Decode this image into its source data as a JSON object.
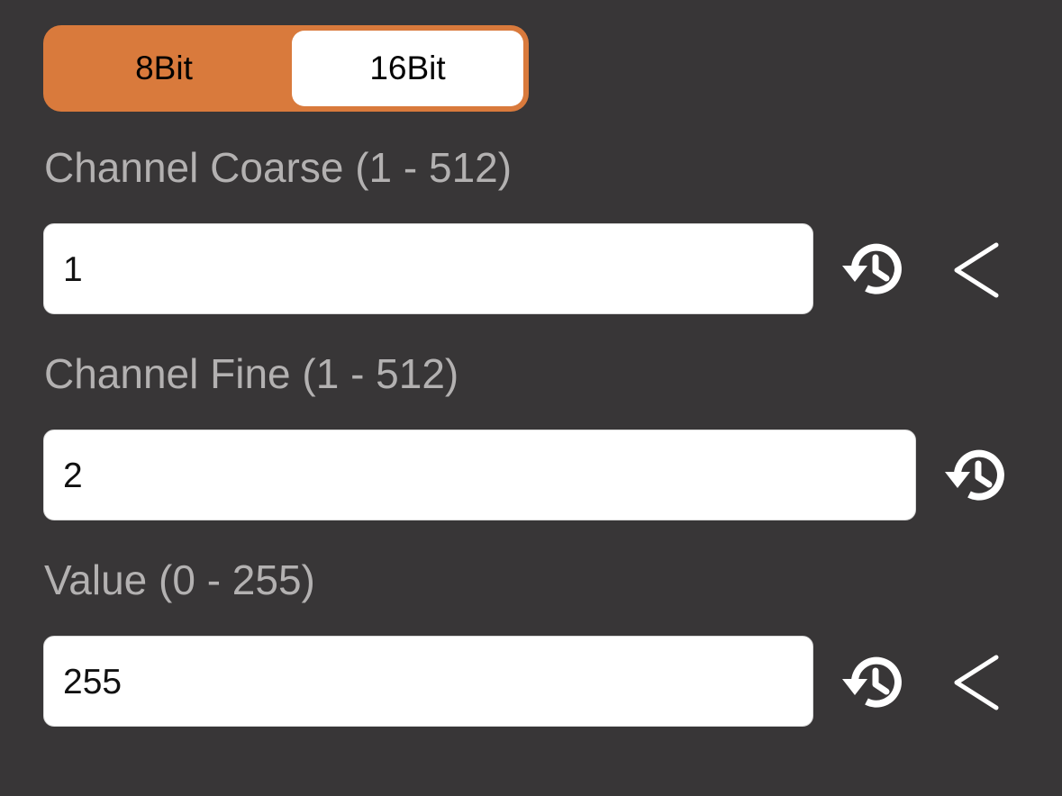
{
  "bit_mode": {
    "options": [
      "8Bit",
      "16Bit"
    ],
    "selected": "16Bit"
  },
  "fields": [
    {
      "label": "Channel Coarse (1 - 512)",
      "value": "1"
    },
    {
      "label": "Channel Fine (1 - 512)",
      "value": "2"
    },
    {
      "label": "Value (0 - 255)",
      "value": "255"
    }
  ],
  "colors": {
    "background": "#383637",
    "accent": "#d97a3c",
    "label_text": "#b3b1b1",
    "field_background": "#ffffff"
  },
  "icons": {
    "history": "history-icon",
    "back": "chevron-left-icon"
  }
}
